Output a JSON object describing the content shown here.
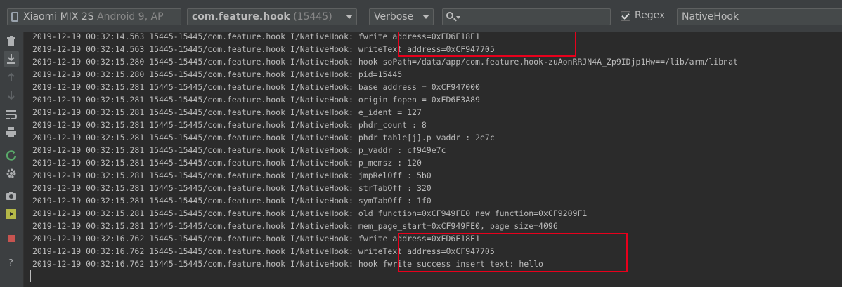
{
  "toolbar": {
    "device_name": "Xiaomi MIX 2S",
    "device_os": "Android 9, AP",
    "process_name": "com.feature.hook",
    "process_pid": "(15445)",
    "log_level": "Verbose",
    "search_value": "",
    "regex_label": "Regex",
    "regex_checked": true,
    "filter": "NativeHook"
  },
  "sidebar": {
    "tools": [
      {
        "name": "trash-icon",
        "active": false
      },
      {
        "name": "scroll-to-end-icon",
        "active": true
      },
      {
        "name": "up-arrow-icon",
        "active": false
      },
      {
        "name": "down-arrow-icon",
        "active": false
      },
      {
        "name": "soft-wrap-icon",
        "active": false
      },
      {
        "name": "print-icon",
        "active": false
      },
      {
        "name": "restart-icon",
        "active": false
      },
      {
        "name": "gear-icon",
        "active": false
      },
      {
        "name": "camera-icon",
        "active": false
      },
      {
        "name": "screen-record-icon",
        "active": false
      },
      {
        "name": "stop-icon",
        "active": false
      },
      {
        "name": "help-icon",
        "active": false
      }
    ]
  },
  "log": {
    "lines": [
      "2019-12-19 00:32:14.563 15445-15445/com.feature.hook I/NativeHook: fwrite address=0xED6E18E1",
      "2019-12-19 00:32:14.563 15445-15445/com.feature.hook I/NativeHook: writeText address=0xCF947705",
      "2019-12-19 00:32:15.280 15445-15445/com.feature.hook I/NativeHook: hook soPath=/data/app/com.feature.hook-zuAonRRJN4A_Zp9IDjp1Hw==/lib/arm/libnat",
      "2019-12-19 00:32:15.280 15445-15445/com.feature.hook I/NativeHook: pid=15445",
      "2019-12-19 00:32:15.281 15445-15445/com.feature.hook I/NativeHook: base address = 0xCF947000",
      "2019-12-19 00:32:15.281 15445-15445/com.feature.hook I/NativeHook: origin fopen = 0xED6E3A89",
      "2019-12-19 00:32:15.281 15445-15445/com.feature.hook I/NativeHook: e_ident = 127",
      "2019-12-19 00:32:15.281 15445-15445/com.feature.hook I/NativeHook: phdr_count : 8",
      "2019-12-19 00:32:15.281 15445-15445/com.feature.hook I/NativeHook: phdr_table[j].p_vaddr : 2e7c",
      "2019-12-19 00:32:15.281 15445-15445/com.feature.hook I/NativeHook: p_vaddr : cf949e7c",
      "2019-12-19 00:32:15.281 15445-15445/com.feature.hook I/NativeHook: p_memsz : 120",
      "2019-12-19 00:32:15.281 15445-15445/com.feature.hook I/NativeHook: jmpRelOff : 5b0",
      "2019-12-19 00:32:15.281 15445-15445/com.feature.hook I/NativeHook: strTabOff : 320",
      "2019-12-19 00:32:15.281 15445-15445/com.feature.hook I/NativeHook: symTabOff : 1f0",
      "2019-12-19 00:32:15.281 15445-15445/com.feature.hook I/NativeHook: old_function=0xCF949FE0 new_function=0xCF9209F1",
      "2019-12-19 00:32:15.281 15445-15445/com.feature.hook I/NativeHook: mem_page_start=0xCF949FE0, page size=4096",
      "2019-12-19 00:32:16.762 15445-15445/com.feature.hook I/NativeHook: fwrite address=0xED6E18E1",
      "2019-12-19 00:32:16.762 15445-15445/com.feature.hook I/NativeHook: writeText address=0xCF947705",
      "2019-12-19 00:32:16.762 15445-15445/com.feature.hook I/NativeHook: hook fwrite success insert text: hello"
    ]
  },
  "colors": {
    "background": "#2b2b2b",
    "toolbar": "#3c3f41",
    "text": "#bbbbbb",
    "highlight_box": "#e8001c"
  }
}
